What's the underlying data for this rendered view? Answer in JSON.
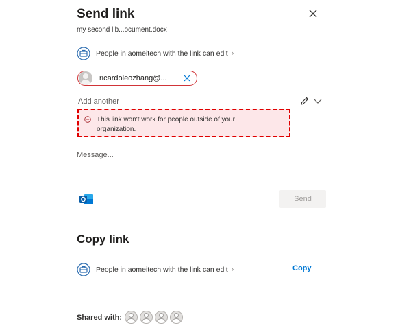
{
  "send_link": {
    "title": "Send link",
    "filename": "my second lib...ocument.docx",
    "close_icon": "close-icon",
    "permission": {
      "text": "People in aomeitech with the link can edit",
      "chevron": "›"
    },
    "recipient": {
      "email": "ricardoleozhang@...",
      "avatar_icon": "person-avatar-icon",
      "remove_icon": "close-icon"
    },
    "add_input": {
      "placeholder": "Add another"
    },
    "warning": {
      "text": "This link won't work for people outside of your organization.",
      "icon": "minus-circle-icon",
      "background": "#fde7e9",
      "border": "#e00000"
    },
    "message": {
      "placeholder": "Message..."
    },
    "send_button": "Send"
  },
  "copy_link": {
    "title": "Copy link",
    "permission": {
      "text": "People in aomeitech with the link can edit",
      "chevron": "›"
    },
    "copy_button": "Copy"
  },
  "shared_with": {
    "label": "Shared with:",
    "avatars": [
      "avatar",
      "avatar",
      "avatar",
      "avatar"
    ]
  },
  "colors": {
    "accent": "#0078d4",
    "error": "#d13438"
  }
}
